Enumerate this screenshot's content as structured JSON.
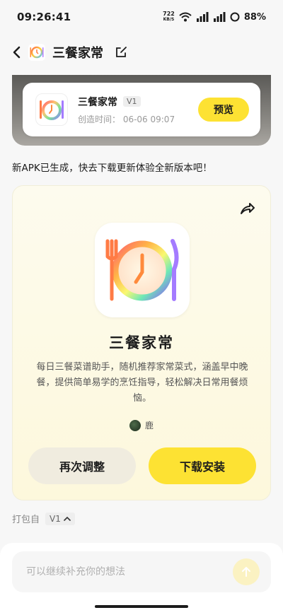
{
  "status_bar": {
    "time": "09:26:41",
    "net_speed_value": "722",
    "net_speed_unit": "KB/S",
    "battery": "88%"
  },
  "header": {
    "title": "三餐家常"
  },
  "version_card": {
    "name": "三餐家常",
    "version": "V1",
    "created_time": "创造时间： 06-06 09:07",
    "preview_label": "预览"
  },
  "message": "新APK已生成，快去下载更新体验全新版本吧！",
  "app_card": {
    "name": "三餐家常",
    "description": "每日三餐菜谱助手，随机推荐家常菜式，涵盖早中晚餐，提供简单易学的烹饪指导，轻松解决日常用餐烦恼。",
    "author": "鹿",
    "adjust_label": "再次调整",
    "install_label": "下载安装"
  },
  "packed_from": {
    "label": "打包自",
    "version": "V1"
  },
  "input": {
    "placeholder": "可以继续补充你的想法"
  },
  "colors": {
    "accent": "#fde233",
    "card_bg": "#fdfbee"
  }
}
